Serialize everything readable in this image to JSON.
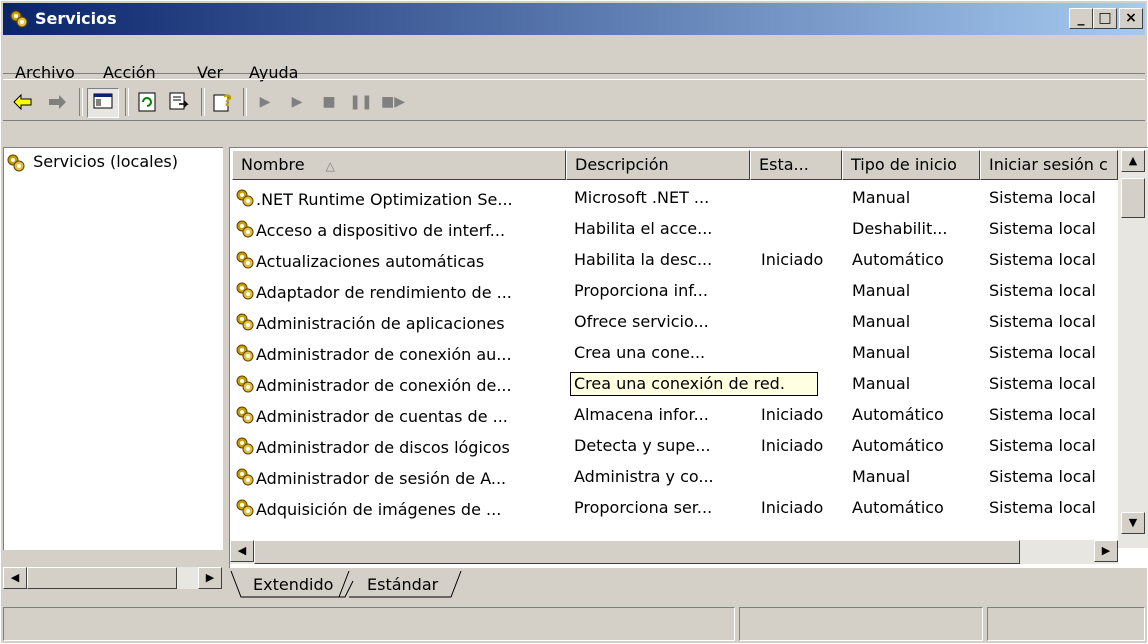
{
  "window": {
    "title": "Servicios"
  },
  "menu": {
    "items": [
      {
        "pre": "Arc",
        "key": "h",
        "post": "ivo"
      },
      {
        "pre": "",
        "key": "A",
        "post": "cción"
      },
      {
        "pre": "",
        "key": "V",
        "post": "er"
      },
      {
        "pre": "Ay",
        "key": "u",
        "post": "da"
      }
    ]
  },
  "tree": {
    "root": "Servicios (locales)"
  },
  "columns": {
    "name": "Nombre",
    "desc": "Descripción",
    "state": "Esta...",
    "start": "Tipo de inicio",
    "logon": "Iniciar sesión c"
  },
  "rows": [
    {
      "name": ".NET Runtime Optimization Se...",
      "desc": "Microsoft .NET ...",
      "state": "",
      "start": "Manual",
      "logon": "Sistema local"
    },
    {
      "name": "Acceso a dispositivo de interf...",
      "desc": "Habilita el acce...",
      "state": "",
      "start": "Deshabilit...",
      "logon": "Sistema local"
    },
    {
      "name": "Actualizaciones automáticas",
      "desc": "Habilita la desc...",
      "state": "Iniciado",
      "start": "Automático",
      "logon": "Sistema local"
    },
    {
      "name": "Adaptador de rendimiento de ...",
      "desc": "Proporciona inf...",
      "state": "",
      "start": "Manual",
      "logon": "Sistema local"
    },
    {
      "name": "Administración de aplicaciones",
      "desc": "Ofrece servicio...",
      "state": "",
      "start": "Manual",
      "logon": "Sistema local"
    },
    {
      "name": "Administrador de conexión au...",
      "desc": "Crea una cone...",
      "state": "",
      "start": "Manual",
      "logon": "Sistema local"
    },
    {
      "name": "Administrador de conexión de...",
      "desc": "",
      "state": "",
      "start": "Manual",
      "logon": "Sistema local"
    },
    {
      "name": "Administrador de cuentas de ...",
      "desc": "Almacena infor...",
      "state": "Iniciado",
      "start": "Automático",
      "logon": "Sistema local"
    },
    {
      "name": "Administrador de discos lógicos",
      "desc": "Detecta y supe...",
      "state": "Iniciado",
      "start": "Automático",
      "logon": "Sistema local"
    },
    {
      "name": "Administrador de sesión de A...",
      "desc": "Administra y co...",
      "state": "",
      "start": "Manual",
      "logon": "Sistema local"
    },
    {
      "name": "Adquisición de imágenes de ...",
      "desc": "Proporciona ser...",
      "state": "Iniciado",
      "start": "Automático",
      "logon": "Sistema local"
    }
  ],
  "tooltip": {
    "text": "Crea una conexión de red.",
    "row_index": 6
  },
  "tabs": {
    "extended": "Extendido",
    "standard": "Estándar"
  },
  "colors": {
    "title_start": "#0a246a",
    "title_end": "#a6caf0",
    "face": "#d4d0c8",
    "tooltip_bg": "#ffffe1"
  },
  "icons": [
    "services-gear-icon",
    "back-arrow-icon",
    "forward-arrow-icon",
    "show-tree-icon",
    "refresh-icon",
    "export-list-icon",
    "help-icon",
    "start-service-icon",
    "stop-service-icon",
    "pause-service-icon",
    "resume-service-icon"
  ]
}
